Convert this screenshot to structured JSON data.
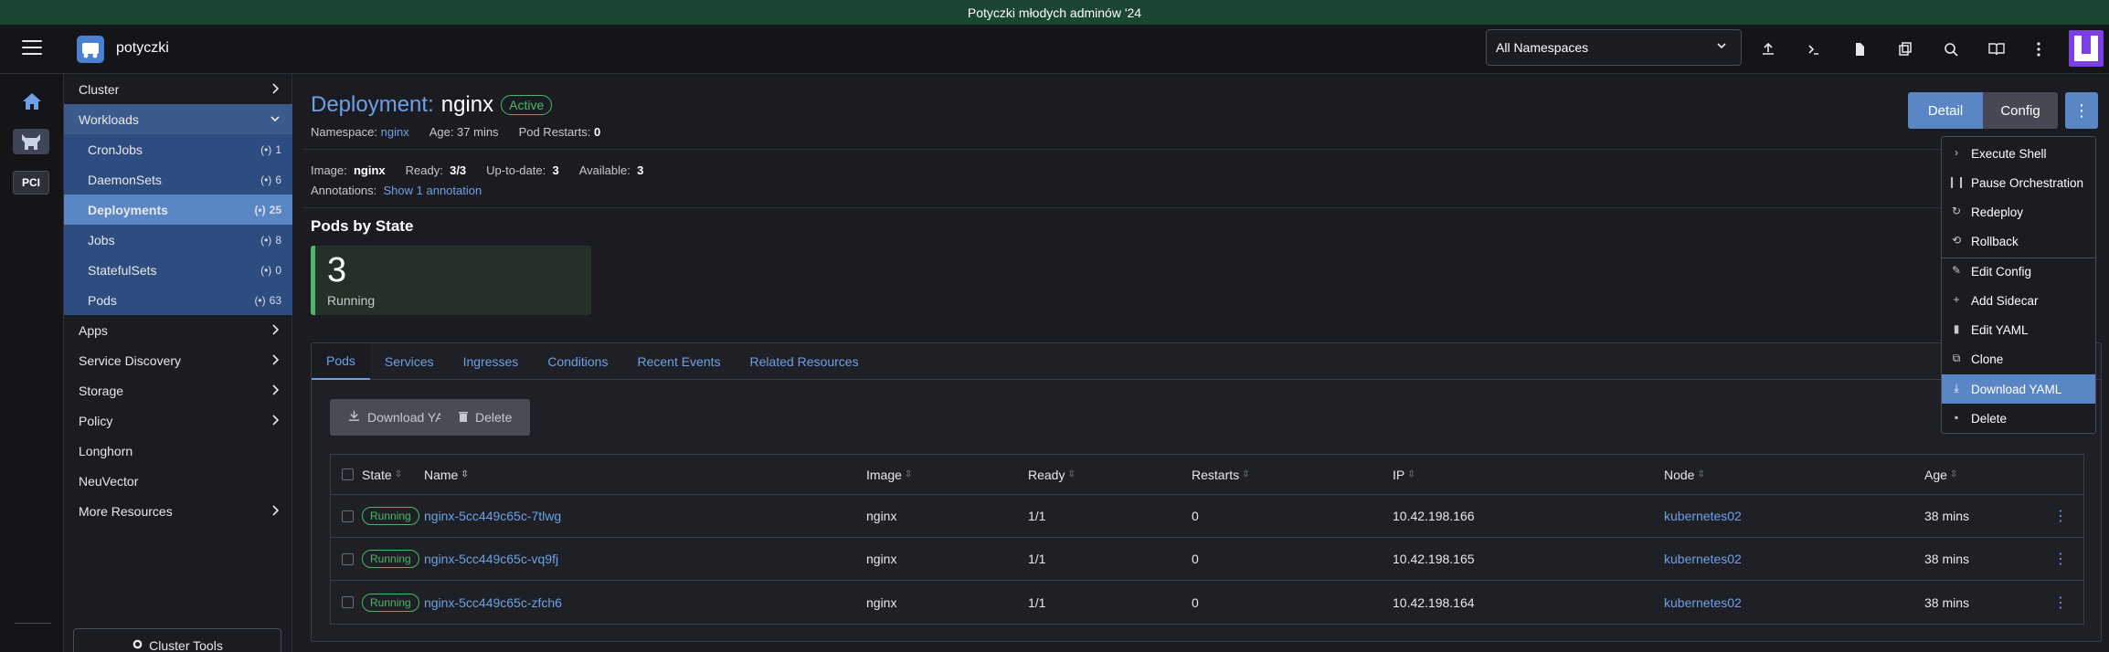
{
  "banner": {
    "text": "Potyczki młodych adminów '24"
  },
  "header": {
    "cluster_name": "potyczki",
    "namespace_select": "All Namespaces"
  },
  "rail": {
    "pci_label": "PCI"
  },
  "sidenav": {
    "items": [
      {
        "label": "Cluster"
      },
      {
        "label": "Workloads"
      },
      {
        "label": "CronJobs",
        "count": "1"
      },
      {
        "label": "DaemonSets",
        "count": "6"
      },
      {
        "label": "Deployments",
        "count": "25"
      },
      {
        "label": "Jobs",
        "count": "8"
      },
      {
        "label": "StatefulSets",
        "count": "0"
      },
      {
        "label": "Pods",
        "count": "63"
      },
      {
        "label": "Apps"
      },
      {
        "label": "Service Discovery"
      },
      {
        "label": "Storage"
      },
      {
        "label": "Policy"
      },
      {
        "label": "Longhorn"
      },
      {
        "label": "NeuVector"
      },
      {
        "label": "More Resources"
      }
    ],
    "cluster_tools": "Cluster Tools"
  },
  "page": {
    "kind": "Deployment:",
    "name": "nginx",
    "status": "Active",
    "namespace_label": "Namespace:",
    "namespace_value": "nginx",
    "age": "Age: 37 mins",
    "restarts_label": "Pod Restarts:",
    "restarts_value": "0",
    "image_label": "Image:",
    "image_value": "nginx",
    "ready_label": "Ready:",
    "ready_value": "3/3",
    "uptodate_label": "Up-to-date:",
    "uptodate_value": "3",
    "available_label": "Available:",
    "available_value": "3",
    "annotations_label": "Annotations:",
    "annotations_link": "Show 1 annotation",
    "detail_btn": "Detail",
    "config_btn": "Config"
  },
  "pods_by_state": {
    "title": "Pods by State",
    "count": "3",
    "label": "Running"
  },
  "tabs": [
    "Pods",
    "Services",
    "Ingresses",
    "Conditions",
    "Recent Events",
    "Related Resources"
  ],
  "actions": {
    "download": "Download YAML",
    "delete": "Delete"
  },
  "table": {
    "headers": [
      "State",
      "Name",
      "Image",
      "Ready",
      "Restarts",
      "IP",
      "Node",
      "Age"
    ],
    "rows": [
      {
        "state": "Running",
        "name": "nginx-5cc449c65c-7tlwg",
        "image": "nginx",
        "ready": "1/1",
        "restarts": "0",
        "ip": "10.42.198.166",
        "node": "kubernetes02",
        "age": "38 mins"
      },
      {
        "state": "Running",
        "name": "nginx-5cc449c65c-vq9fj",
        "image": "nginx",
        "ready": "1/1",
        "restarts": "0",
        "ip": "10.42.198.165",
        "node": "kubernetes02",
        "age": "38 mins"
      },
      {
        "state": "Running",
        "name": "nginx-5cc449c65c-zfch6",
        "image": "nginx",
        "ready": "1/1",
        "restarts": "0",
        "ip": "10.42.198.164",
        "node": "kubernetes02",
        "age": "38 mins"
      }
    ]
  },
  "menu": {
    "items": [
      {
        "label": "Execute Shell",
        "icon": "chevron-right-icon"
      },
      {
        "label": "Pause Orchestration",
        "icon": "pause-icon"
      },
      {
        "label": "Redeploy",
        "icon": "refresh-icon"
      },
      {
        "label": "Rollback",
        "icon": "history-icon"
      },
      {
        "label": "Edit Config",
        "icon": "pencil-icon"
      },
      {
        "label": "Add Sidecar",
        "icon": "plus-icon"
      },
      {
        "label": "Edit YAML",
        "icon": "file-icon"
      },
      {
        "label": "Clone",
        "icon": "copy-icon"
      },
      {
        "label": "Download YAML",
        "icon": "download-icon"
      },
      {
        "label": "Delete",
        "icon": "trash-icon"
      }
    ]
  }
}
